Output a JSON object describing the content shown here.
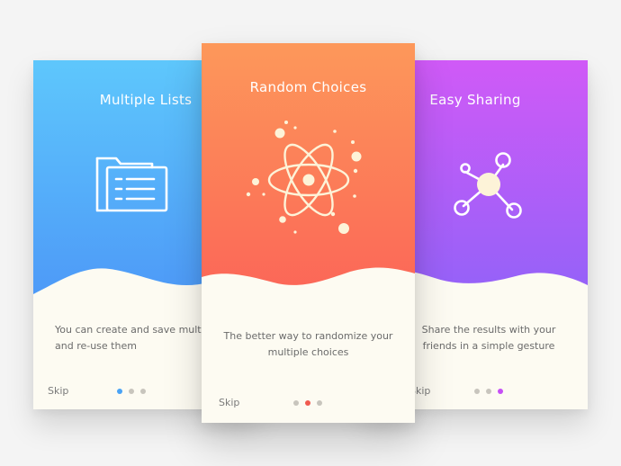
{
  "colors": {
    "card_bg": "#fdfbf2",
    "blue_top": "#5ec7fc",
    "blue_bottom": "#4b93f7",
    "orange_top": "#fd985a",
    "orange_bottom": "#fb5f57",
    "purple_top": "#d05af7",
    "purple_bottom": "#8b63f8",
    "dot_inactive": "#c8c5bd",
    "dot_active_blue": "#4aa3f5",
    "dot_active_red": "#f05a4f",
    "dot_active_purple": "#c64ff5"
  },
  "cards": [
    {
      "title": "Multiple Lists",
      "description": "You can create and save multiple lists and re-use them",
      "skip_label": "Skip",
      "icon": "folder-list-icon",
      "active_dot": 0
    },
    {
      "title": "Random Choices",
      "description": "The better way to randomize your multiple choices",
      "skip_label": "Skip",
      "icon": "atom-icon",
      "active_dot": 1
    },
    {
      "title": "Easy Sharing",
      "description": "Share the results with your friends in a simple gesture",
      "skip_label": "Skip",
      "icon": "share-network-icon",
      "active_dot": 2
    }
  ]
}
